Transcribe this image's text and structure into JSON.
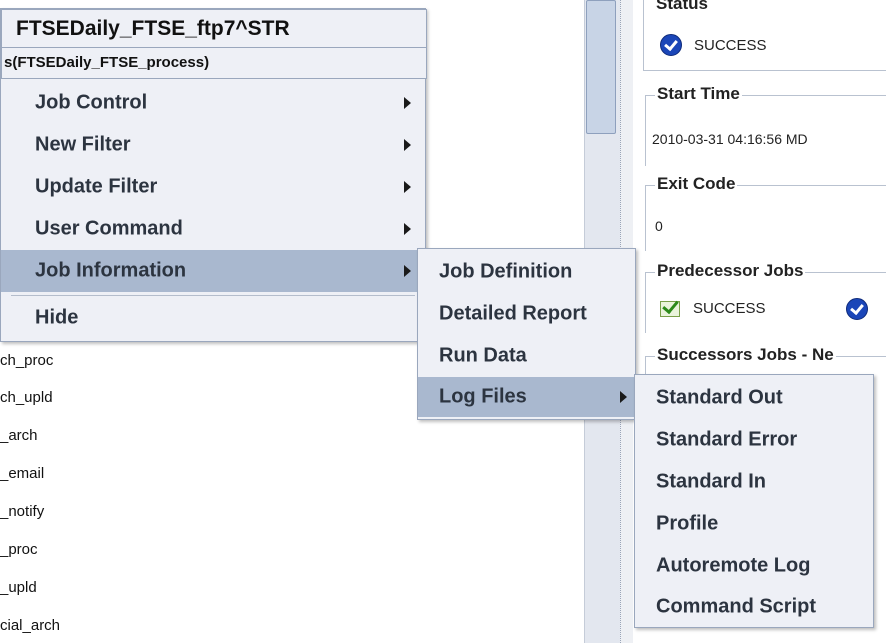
{
  "header": {
    "job_name": "FTSEDaily_FTSE_ftp7^STR",
    "box_name": "s(FTSEDaily_FTSE_process)"
  },
  "context_menu": {
    "items": [
      {
        "label": "Job Control",
        "has_submenu": true
      },
      {
        "label": "New Filter",
        "has_submenu": true
      },
      {
        "label": "Update Filter",
        "has_submenu": true
      },
      {
        "label": "User Command",
        "has_submenu": true
      },
      {
        "label": "Job Information",
        "has_submenu": true,
        "highlighted": true
      },
      {
        "label": "Hide",
        "has_submenu": false
      }
    ]
  },
  "job_info_menu": {
    "items": [
      {
        "label": "Job Definition"
      },
      {
        "label": "Detailed Report"
      },
      {
        "label": "Run Data"
      },
      {
        "label": "Log Files",
        "has_submenu": true,
        "highlighted": true
      }
    ]
  },
  "log_files_menu": {
    "items": [
      {
        "label": "Standard Out"
      },
      {
        "label": "Standard Error"
      },
      {
        "label": "Standard In"
      },
      {
        "label": "Profile"
      },
      {
        "label": "Autoremote Log"
      },
      {
        "label": "Command Script"
      }
    ]
  },
  "tree": {
    "rows": [
      "ch_proc",
      "ch_upld",
      "_arch",
      "_email",
      "_notify",
      "_proc",
      "_upld",
      "cial_arch"
    ]
  },
  "details": {
    "status_title": "Status",
    "status_value": "SUCCESS",
    "start_time_title": "Start Time",
    "start_time_value": "2010-03-31 04:16:56 MD",
    "exit_code_title": "Exit Code",
    "exit_code_value": "0",
    "predecessor_title": "Predecessor Jobs",
    "predecessor_value": "SUCCESS",
    "successors_title": "Successors Jobs - Ne"
  },
  "colors": {
    "menu_bg": "#eef0f6",
    "menu_highlight": "#a9b8cf",
    "success_blue": "#1b46b8",
    "success_green": "#2d8a1a"
  }
}
